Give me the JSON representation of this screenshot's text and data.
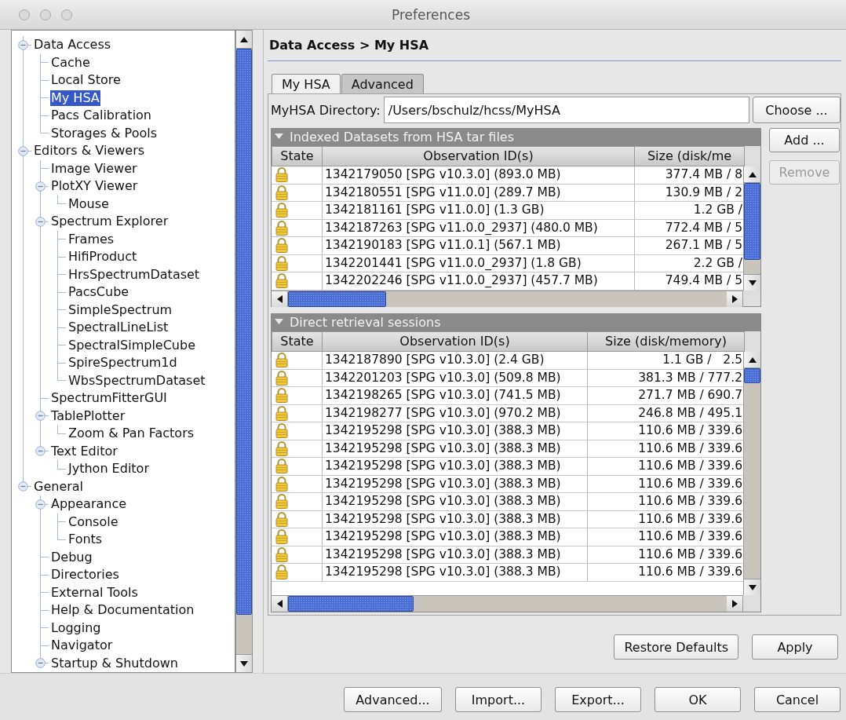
{
  "window": {
    "title": "Preferences"
  },
  "tree": [
    {
      "label": "Data Access",
      "selected": false,
      "expanded": true,
      "children": [
        {
          "label": "Cache",
          "selected": false
        },
        {
          "label": "Local Store",
          "selected": false
        },
        {
          "label": "My HSA",
          "selected": true
        },
        {
          "label": "Pacs Calibration",
          "selected": false
        },
        {
          "label": "Storages & Pools",
          "selected": false
        }
      ]
    },
    {
      "label": "Editors & Viewers",
      "selected": false,
      "expanded": true,
      "children": [
        {
          "label": "Image Viewer",
          "selected": false
        },
        {
          "label": "PlotXY Viewer",
          "selected": false,
          "expanded": true,
          "children": [
            {
              "label": "Mouse",
              "selected": false
            }
          ]
        },
        {
          "label": "Spectrum Explorer",
          "selected": false,
          "expanded": true,
          "children": [
            {
              "label": "Frames",
              "selected": false
            },
            {
              "label": "HifiProduct",
              "selected": false
            },
            {
              "label": "HrsSpectrumDataset",
              "selected": false
            },
            {
              "label": "PacsCube",
              "selected": false
            },
            {
              "label": "SimpleSpectrum",
              "selected": false
            },
            {
              "label": "SpectralLineList",
              "selected": false
            },
            {
              "label": "SpectralSimpleCube",
              "selected": false
            },
            {
              "label": "SpireSpectrum1d",
              "selected": false
            },
            {
              "label": "WbsSpectrumDataset",
              "selected": false
            }
          ]
        },
        {
          "label": "SpectrumFitterGUI",
          "selected": false
        },
        {
          "label": "TablePlotter",
          "selected": false,
          "expanded": true,
          "children": [
            {
              "label": "Zoom & Pan Factors",
              "selected": false
            }
          ]
        },
        {
          "label": "Text Editor",
          "selected": false,
          "expanded": true,
          "children": [
            {
              "label": "Jython Editor",
              "selected": false
            }
          ]
        }
      ]
    },
    {
      "label": "General",
      "selected": false,
      "expanded": true,
      "children": [
        {
          "label": "Appearance",
          "selected": false,
          "expanded": true,
          "children": [
            {
              "label": "Console",
              "selected": false
            },
            {
              "label": "Fonts",
              "selected": false
            }
          ]
        },
        {
          "label": "Debug",
          "selected": false
        },
        {
          "label": "Directories",
          "selected": false
        },
        {
          "label": "External Tools",
          "selected": false
        },
        {
          "label": "Help & Documentation",
          "selected": false
        },
        {
          "label": "Logging",
          "selected": false
        },
        {
          "label": "Navigator",
          "selected": false
        },
        {
          "label": "Startup & Shutdown",
          "selected": false,
          "expanded": true
        }
      ]
    }
  ],
  "page": {
    "breadcrumb": "Data Access > My HSA"
  },
  "tabs": [
    {
      "label": "My HSA",
      "selected": true
    },
    {
      "label": "Advanced",
      "selected": false
    }
  ],
  "directory": {
    "label": "MyHSA Directory:",
    "value": "/Users/bschulz/hcss/MyHSA",
    "button": "Choose ..."
  },
  "side_buttons": [
    {
      "label": "Add ...",
      "disabled": false
    },
    {
      "label": "Remove",
      "disabled": true
    }
  ],
  "tables": [
    {
      "title": "Indexed Datasets from HSA tar files",
      "expanded": true,
      "columns": [
        "State",
        "Observation ID(s)",
        "Size (disk/me"
      ],
      "rows": [
        {
          "locked": true,
          "observation": "1342179050 [SPG v10.3.0] (893.0 MB)",
          "size": "377.4 MB / 8"
        },
        {
          "locked": true,
          "observation": "1342180551 [SPG v11.0.0] (289.7 MB)",
          "size": "130.9 MB / 2"
        },
        {
          "locked": true,
          "observation": "1342181161 [SPG v11.0.0] (1.3 GB)",
          "size": "1.2 GB /"
        },
        {
          "locked": true,
          "observation": "1342187263 [SPG v11.0.0_2937] (480.0 MB)",
          "size": "772.4 MB / 5"
        },
        {
          "locked": true,
          "observation": "1342190183 [SPG v11.0.1] (567.1 MB)",
          "size": "267.1 MB / 5"
        },
        {
          "locked": true,
          "observation": "1342201441 [SPG v11.0.0_2937] (1.8 GB)",
          "size": "2.2 GB /"
        },
        {
          "locked": true,
          "observation": "1342202246 [SPG v11.0.0_2937] (457.7 MB)",
          "size": "749.4 MB / 5"
        }
      ]
    },
    {
      "title": "Direct retrieval sessions",
      "expanded": true,
      "columns": [
        "State",
        "Observation ID(s)",
        "Size (disk/memory)"
      ],
      "rows": [
        {
          "locked": true,
          "observation": "1342187890 [SPG v10.3.0] (2.4 GB)",
          "size": "1.1 GB /   2.5"
        },
        {
          "locked": true,
          "observation": "1342201203 [SPG v10.3.0] (509.8 MB)",
          "size": "381.3 MB / 777.2"
        },
        {
          "locked": true,
          "observation": "1342198265 [SPG v10.3.0] (741.5 MB)",
          "size": "271.7 MB / 690.7"
        },
        {
          "locked": true,
          "observation": "1342198277 [SPG v10.3.0] (970.2 MB)",
          "size": "246.8 MB / 495.1"
        },
        {
          "locked": true,
          "observation": "1342195298 [SPG v10.3.0] (388.3 MB)",
          "size": "110.6 MB / 339.6"
        },
        {
          "locked": true,
          "observation": "1342195298 [SPG v10.3.0] (388.3 MB)",
          "size": "110.6 MB / 339.6"
        },
        {
          "locked": true,
          "observation": "1342195298 [SPG v10.3.0] (388.3 MB)",
          "size": "110.6 MB / 339.6"
        },
        {
          "locked": true,
          "observation": "1342195298 [SPG v10.3.0] (388.3 MB)",
          "size": "110.6 MB / 339.6"
        },
        {
          "locked": true,
          "observation": "1342195298 [SPG v10.3.0] (388.3 MB)",
          "size": "110.6 MB / 339.6"
        },
        {
          "locked": true,
          "observation": "1342195298 [SPG v10.3.0] (388.3 MB)",
          "size": "110.6 MB / 339.6"
        },
        {
          "locked": true,
          "observation": "1342195298 [SPG v10.3.0] (388.3 MB)",
          "size": "110.6 MB / 339.6"
        },
        {
          "locked": true,
          "observation": "1342195298 [SPG v10.3.0] (388.3 MB)",
          "size": "110.6 MB / 339.6"
        },
        {
          "locked": true,
          "observation": "1342195298 [SPG v10.3.0] (388.3 MB)",
          "size": "110.6 MB / 339.6"
        }
      ]
    }
  ],
  "page_buttons": [
    "Restore Defaults",
    "Apply"
  ],
  "dialog_buttons": [
    "Advanced...",
    "Import...",
    "Export...",
    "OK",
    "Cancel"
  ]
}
